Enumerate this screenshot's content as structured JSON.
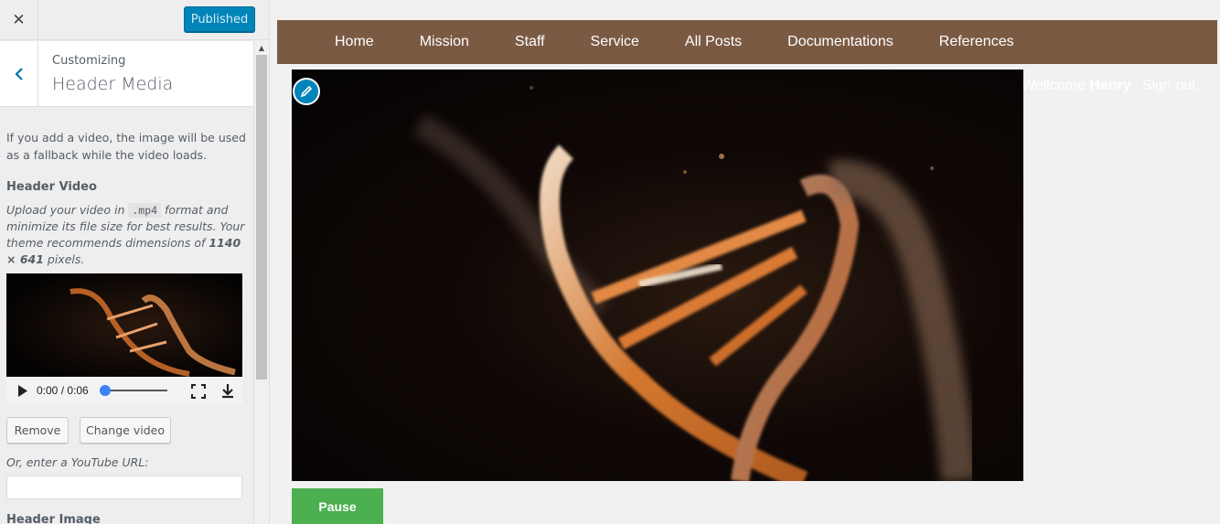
{
  "customizer": {
    "close_icon": "close-icon",
    "publish_label": "Published",
    "breadcrumb": "Customizing",
    "section_title": "Header Media",
    "intro": "If you add a video, the image will be used as a fallback while the video loads.",
    "header_video": {
      "title": "Header Video",
      "desc_1": "Upload your video in ",
      "format": ".mp4",
      "desc_2": " format and minimize its file size for best results. Your theme recommends dimensions of ",
      "dimensions": "1140 × 641",
      "desc_3": " pixels.",
      "time": "0:00 / 0:06",
      "progress": 0.0,
      "remove_label": "Remove",
      "change_label": "Change video",
      "youtube_label": "Or, enter a YouTube URL:",
      "youtube_value": ""
    },
    "header_image_title": "Header Image"
  },
  "preview": {
    "nav": [
      "Home",
      "Mission",
      "Staff",
      "Service",
      "All Posts",
      "Documentations",
      "References"
    ],
    "welcome_prefix": "Wellcome ",
    "user_name": "Henry",
    "signout_label": "Sign out",
    "pause_label": "Pause"
  },
  "colors": {
    "accent": "#0085ba",
    "nav_bg": "#7b5a44",
    "pause_bg": "#4caf50"
  }
}
